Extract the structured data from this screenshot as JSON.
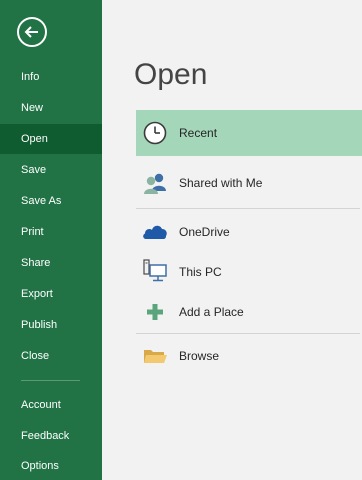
{
  "sidebar": {
    "back_icon": "back-arrow-icon",
    "items": [
      {
        "label": "Info"
      },
      {
        "label": "New"
      },
      {
        "label": "Open",
        "active": true
      },
      {
        "label": "Save"
      },
      {
        "label": "Save As"
      },
      {
        "label": "Print"
      },
      {
        "label": "Share"
      },
      {
        "label": "Export"
      },
      {
        "label": "Publish"
      },
      {
        "label": "Close"
      },
      {
        "label": "Account"
      },
      {
        "label": "Feedback"
      },
      {
        "label": "Options"
      }
    ],
    "colors": {
      "background": "#217346",
      "active": "#0e5c30",
      "text": "#ffffff"
    }
  },
  "main": {
    "title": "Open",
    "locations": [
      {
        "label": "Recent",
        "icon": "clock-icon",
        "selected": true
      },
      {
        "label": "Shared with Me",
        "icon": "people-icon"
      },
      {
        "label": "OneDrive",
        "icon": "cloud-icon"
      },
      {
        "label": "This PC",
        "icon": "computer-icon"
      },
      {
        "label": "Add a Place",
        "icon": "plus-icon"
      },
      {
        "label": "Browse",
        "icon": "folder-icon"
      }
    ],
    "colors": {
      "selected": "#a4d7b9",
      "background": "#f2f2f2"
    }
  }
}
